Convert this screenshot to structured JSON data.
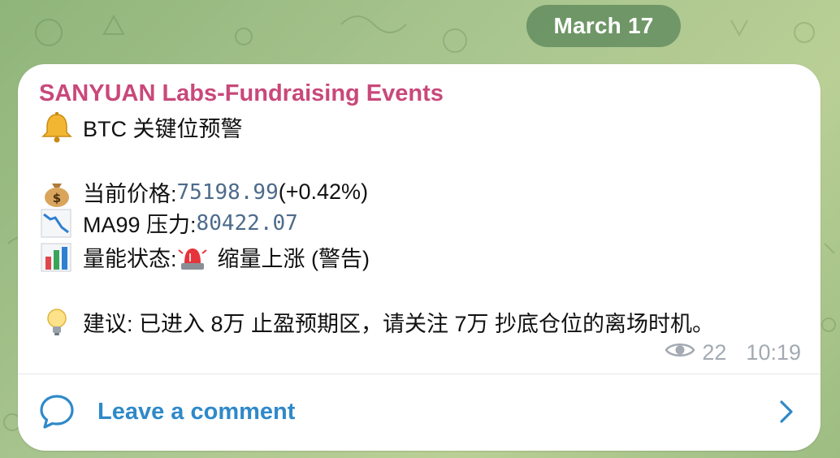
{
  "date_pill": "March 17",
  "message": {
    "channel_name": "SANYUAN Labs-Fundraising Events",
    "title": "BTC 关键位预警",
    "price_label": "当前价格: ",
    "price_value": "75198.99",
    "price_change": " (+0.42%)",
    "ma_label": "MA99 压力: ",
    "ma_value": "80422.07",
    "volume_label": "量能状态: ",
    "volume_status": "缩量上涨 (警告)",
    "advice": "建议: 已进入 8万 止盈预期区，请关注 7万 抄底仓位的离场时机。",
    "views": "22",
    "time": "10:19"
  },
  "comment": {
    "label": "Leave a comment"
  },
  "icons": {
    "title": "bell-icon",
    "price": "money-bag-icon",
    "ma": "chart-decreasing-icon",
    "volume": "bar-chart-icon",
    "siren": "police-light-icon",
    "advice": "light-bulb-icon",
    "views": "eye-icon",
    "comment": "comment-bubble-icon",
    "chevron": "chevron-right-icon"
  },
  "colors": {
    "channel_name": "#c9487a",
    "code_values": "#4d6b8a",
    "link": "#2f89c9",
    "meta": "#a3aab2"
  }
}
